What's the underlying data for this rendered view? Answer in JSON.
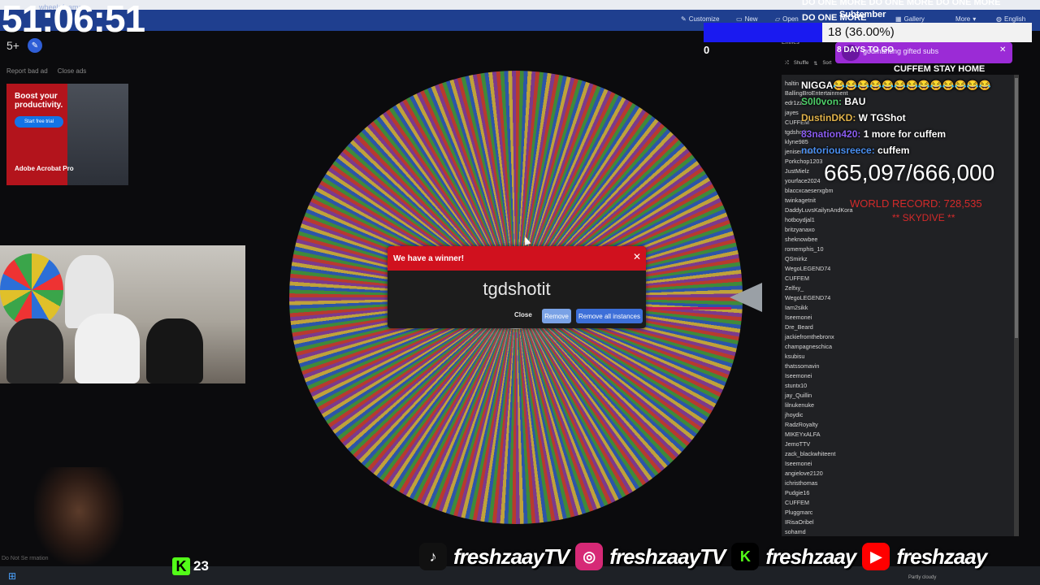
{
  "browser": {
    "wheel_name": "wheelofnames",
    "nav": {
      "customize": "Customize",
      "new": "New",
      "open": "Open",
      "gallery": "Gallery",
      "more": "More",
      "language": "English"
    }
  },
  "stream": {
    "timer": "51:06:51",
    "age_badge": "5+",
    "score_left": "0",
    "marquee": "DO ONE MORE DO ONE MORE DO ONE MORE",
    "marquee2": "DO ONE MORE",
    "subtember": "Subtember",
    "sub_goal": "18 (36.00%)",
    "days_left": "8 DAYS TO GO",
    "gift_text": "godmanting gifted subs",
    "cuffem_stat": "CUFFEM STAY HOME",
    "counter": "665,097/666,000",
    "record": "WORLD RECORD: 728,535",
    "record_holder": "** SKYDIVE **",
    "kick_viewers": "23",
    "footer_left": "Do Not Se                    rmation",
    "weather": "Partly cloudy"
  },
  "ad": {
    "links": [
      "Report bad ad",
      "Close ads"
    ],
    "headline": "Boost your productivity.",
    "cta": "Start free trial",
    "brand": "Adobe Acrobat Pro"
  },
  "dialog": {
    "title": "We have a winner!",
    "winner": "tgdshotit",
    "close_label": "Close",
    "remove_label": "Remove",
    "remove_all_label": "Remove all instances"
  },
  "entries": {
    "label": "Entries",
    "tabs": [
      "Shuffle",
      "Sort"
    ],
    "names": [
      "haltin",
      "BallingBroEntertainment",
      "edr1zz",
      "jayes",
      "CUFFEM",
      "tgdshotit",
      "klyne985",
      "jeniserrifdo",
      "Porkchop1203",
      "JustMielz",
      "yourface2024",
      "blaccxcaeserxgbm",
      "twinkagetnit",
      "DaddyLuvsKailynAndKora",
      "hotboydjal1",
      "britzyanaxo",
      "sheknowbee",
      "romemphis_10",
      "QSmirkz",
      "WegoLEGEND74",
      "CUFFEM",
      "Zelfxy_",
      "WegoLEGEND74",
      "Iam2sikk",
      "Iseemonei",
      "Dre_Beard",
      "jackiefromthebronx",
      "champagneschica",
      "ksubisu",
      "thatssomavin",
      "Iseemonei",
      "stuntx10",
      "jay_Quillin",
      "lilnukenuke",
      "jhoydic",
      "RadzRoyalty",
      "MIKEYxALFA",
      "JemoTTV",
      "zack_blackwhiteent",
      "Iseemonei",
      "angielove2120",
      "ichristhomas",
      "Pudgie16",
      "CUFFEM",
      "Pluggmarc",
      "IRisaOribel",
      "sohamd"
    ]
  },
  "chat": [
    {
      "user": "",
      "msg": "NIGGA😂😂😂😂😂😂😂😂😂😂😂😂😂",
      "color": "#ffffff"
    },
    {
      "user": "S0l0von",
      "msg": "BAU",
      "color": "#4fd06a"
    },
    {
      "user": "DustinDKD",
      "msg": "W TGShot",
      "color": "#e0b24a"
    },
    {
      "user": "83nation420",
      "msg": "1 more for cuffem",
      "color": "#8a5cf0"
    },
    {
      "user": "notoriousreece",
      "msg": "cuffem",
      "color": "#4a8ff0"
    }
  ],
  "social": [
    {
      "icon": "tiktok-icon",
      "glyph": "♪",
      "bg": "#111111",
      "name": "freshzaayTV"
    },
    {
      "icon": "instagram-icon",
      "glyph": "◎",
      "bg": "#d62976",
      "name": "freshzaayTV"
    },
    {
      "icon": "kick-icon",
      "glyph": "K",
      "bg": "#000000",
      "name": "freshzaay"
    },
    {
      "icon": "youtube-icon",
      "glyph": "▶",
      "bg": "#ff0000",
      "name": "freshzaay"
    }
  ]
}
